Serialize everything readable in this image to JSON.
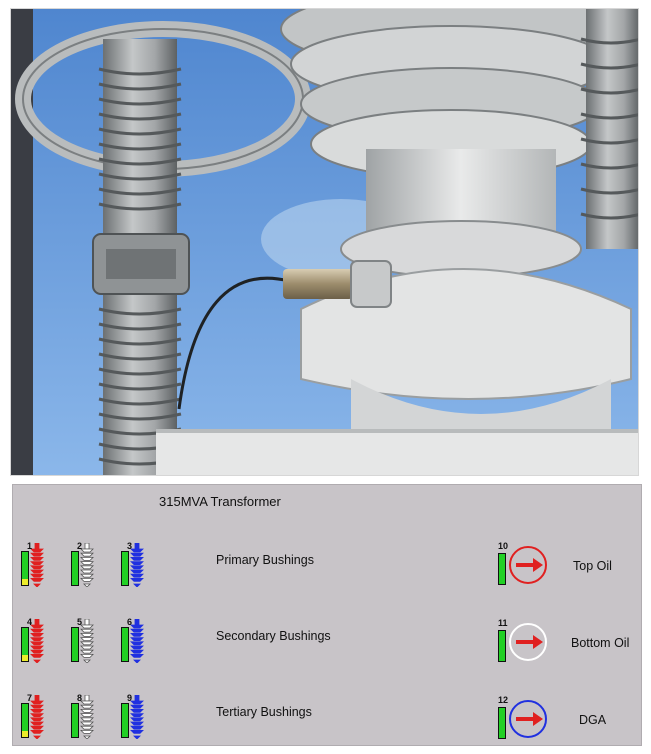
{
  "panel": {
    "title": "315MVA Transformer"
  },
  "bushing_rows": [
    {
      "label": "Primary Bushings",
      "sensors": [
        {
          "number": "1",
          "color": "#e02020",
          "level": 0.18
        },
        {
          "number": "2",
          "color": "#ffffff",
          "level": 0
        },
        {
          "number": "3",
          "color": "#2030e0",
          "level": 0
        }
      ]
    },
    {
      "label": "Secondary Bushings",
      "sensors": [
        {
          "number": "4",
          "color": "#e02020",
          "level": 0.18
        },
        {
          "number": "5",
          "color": "#ffffff",
          "level": 0
        },
        {
          "number": "6",
          "color": "#2030e0",
          "level": 0
        }
      ]
    },
    {
      "label": "Tertiary Bushings",
      "sensors": [
        {
          "number": "7",
          "color": "#e02020",
          "level": 0.18
        },
        {
          "number": "8",
          "color": "#ffffff",
          "level": 0
        },
        {
          "number": "9",
          "color": "#2030e0",
          "level": 0
        }
      ]
    }
  ],
  "oil_sensors": [
    {
      "number": "10",
      "label": "Top Oil",
      "ring_color": "#e02020",
      "arrow_color": "#e02020",
      "icon": "right-arrow-dial"
    },
    {
      "number": "11",
      "label": "Bottom Oil",
      "ring_color": "#ffffff",
      "arrow_color": "#e02020",
      "icon": "right-arrow-dial"
    },
    {
      "number": "12",
      "label": "DGA",
      "ring_color": "#2030e0",
      "arrow_color": "#e02020",
      "icon": "right-arrow-dial"
    }
  ],
  "colors": {
    "panel_bg": "#c8c4c8",
    "status_green": "#22d025",
    "alarm_yellow": "#ecec2c"
  }
}
